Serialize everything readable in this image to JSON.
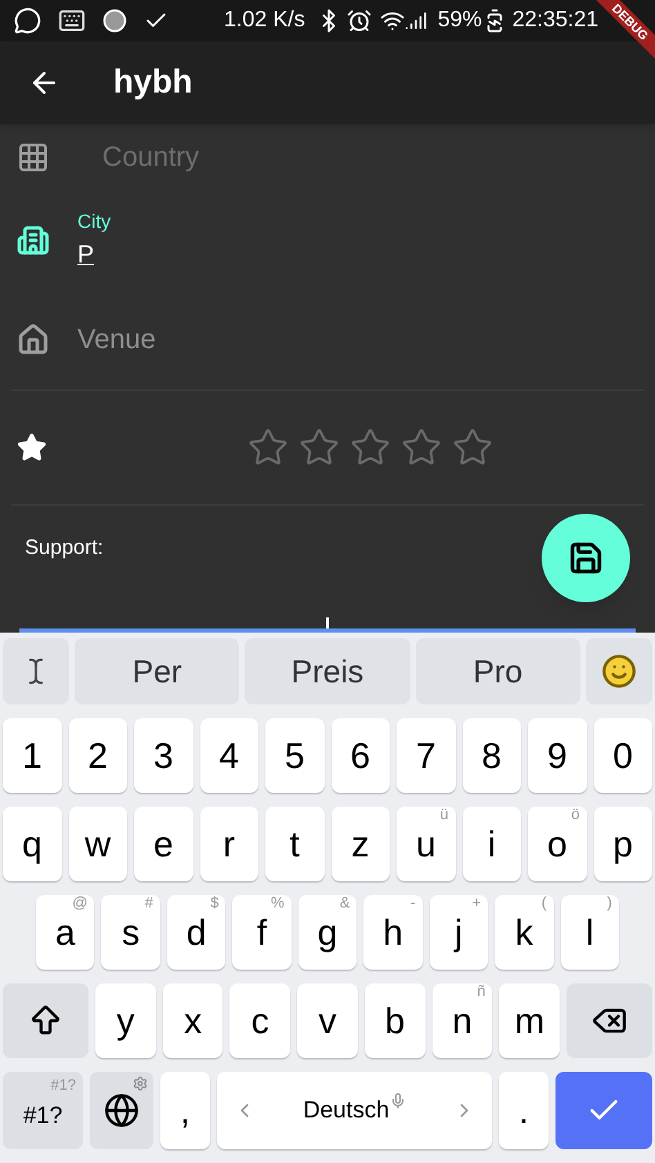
{
  "status_bar": {
    "network_speed": "1.02 K/s",
    "battery": "59%",
    "time": "22:35:21"
  },
  "debug_banner": "DEBUG",
  "app_bar": {
    "title": "hybh"
  },
  "fields": [
    {
      "kind": "country",
      "placeholder": "Country",
      "focused": false
    },
    {
      "kind": "city",
      "label": "City",
      "value": "P",
      "focused": true
    },
    {
      "kind": "venue",
      "placeholder": "Venue",
      "focused": false
    }
  ],
  "rating": {
    "stars": 0
  },
  "support": {
    "label": "Support:"
  },
  "keyboard": {
    "suggestions": [
      "Per",
      "Preis",
      "Pro"
    ],
    "rows": [
      [
        {
          "label": "1"
        },
        {
          "label": "2"
        },
        {
          "label": "3"
        },
        {
          "label": "4"
        },
        {
          "label": "5"
        },
        {
          "label": "6"
        },
        {
          "label": "7"
        },
        {
          "label": "8"
        },
        {
          "label": "9"
        },
        {
          "label": "0"
        }
      ],
      [
        {
          "label": "q"
        },
        {
          "label": "w"
        },
        {
          "label": "e"
        },
        {
          "label": "r"
        },
        {
          "label": "t"
        },
        {
          "label": "z"
        },
        {
          "label": "u",
          "hint": "ü"
        },
        {
          "label": "i"
        },
        {
          "label": "o",
          "hint": "ö"
        },
        {
          "label": "p"
        }
      ],
      [
        {
          "label": "a",
          "hint": "@"
        },
        {
          "label": "s",
          "hint": "#"
        },
        {
          "label": "d",
          "hint": "$"
        },
        {
          "label": "f",
          "hint": "%"
        },
        {
          "label": "g",
          "hint": "&"
        },
        {
          "label": "h",
          "hint": "-"
        },
        {
          "label": "j",
          "hint": "+"
        },
        {
          "label": "k",
          "hint": "("
        },
        {
          "label": "l",
          "hint": ")"
        }
      ],
      [
        {
          "label": "y"
        },
        {
          "label": "x"
        },
        {
          "label": "c"
        },
        {
          "label": "v"
        },
        {
          "label": "b"
        },
        {
          "label": "n",
          "hint": "ñ"
        },
        {
          "label": "m"
        }
      ]
    ],
    "symbols_key": {
      "label": "#1?",
      "hint": "#1?"
    },
    "comma": ",",
    "space": "Deutsch",
    "period": "."
  }
}
